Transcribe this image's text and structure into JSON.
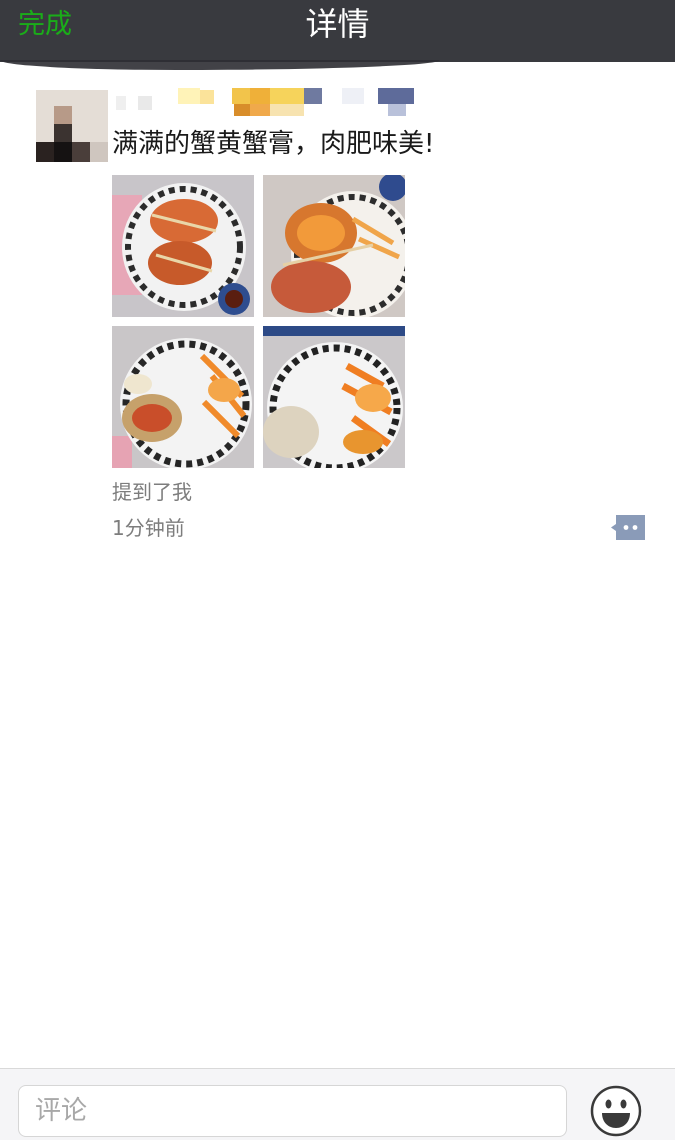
{
  "navbar": {
    "done_label": "完成",
    "title": "详情"
  },
  "post": {
    "text": "满满的蟹黄蟹膏，肉肥味美!",
    "mention": "提到了我",
    "time": "1分钟前",
    "photos": [
      {
        "icon": "crab-photo-icon"
      },
      {
        "icon": "crab-photo-icon"
      },
      {
        "icon": "crab-photo-icon"
      },
      {
        "icon": "crab-photo-icon"
      }
    ]
  },
  "comment_bar": {
    "placeholder": "评论"
  },
  "icons": {
    "comment": "comment-bubble-icon",
    "emoji": "smiley-icon"
  },
  "colors": {
    "navbar_bg": "#393a3f",
    "accent_green": "#1aad19",
    "secondary_text": "#7d7d7d",
    "comment_icon": "#8a9bb8"
  }
}
